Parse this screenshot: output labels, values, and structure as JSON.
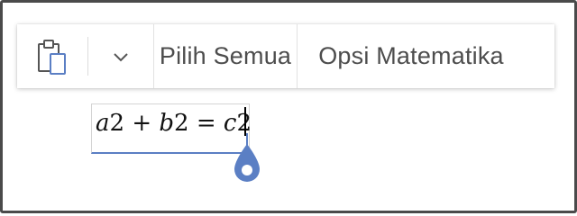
{
  "toolbar": {
    "paste_icon": "clipboard-paste-icon",
    "options_icon": "chevron-down-icon",
    "select_all_label": "Pilih Semua",
    "math_options_label": "Opsi Matematika"
  },
  "equation": {
    "parts": [
      "a",
      "2 + ",
      "b",
      "2 = ",
      "c",
      "2"
    ]
  },
  "colors": {
    "accent": "#5b7fc4",
    "icon": "#555555",
    "text": "#4d4d4d"
  }
}
